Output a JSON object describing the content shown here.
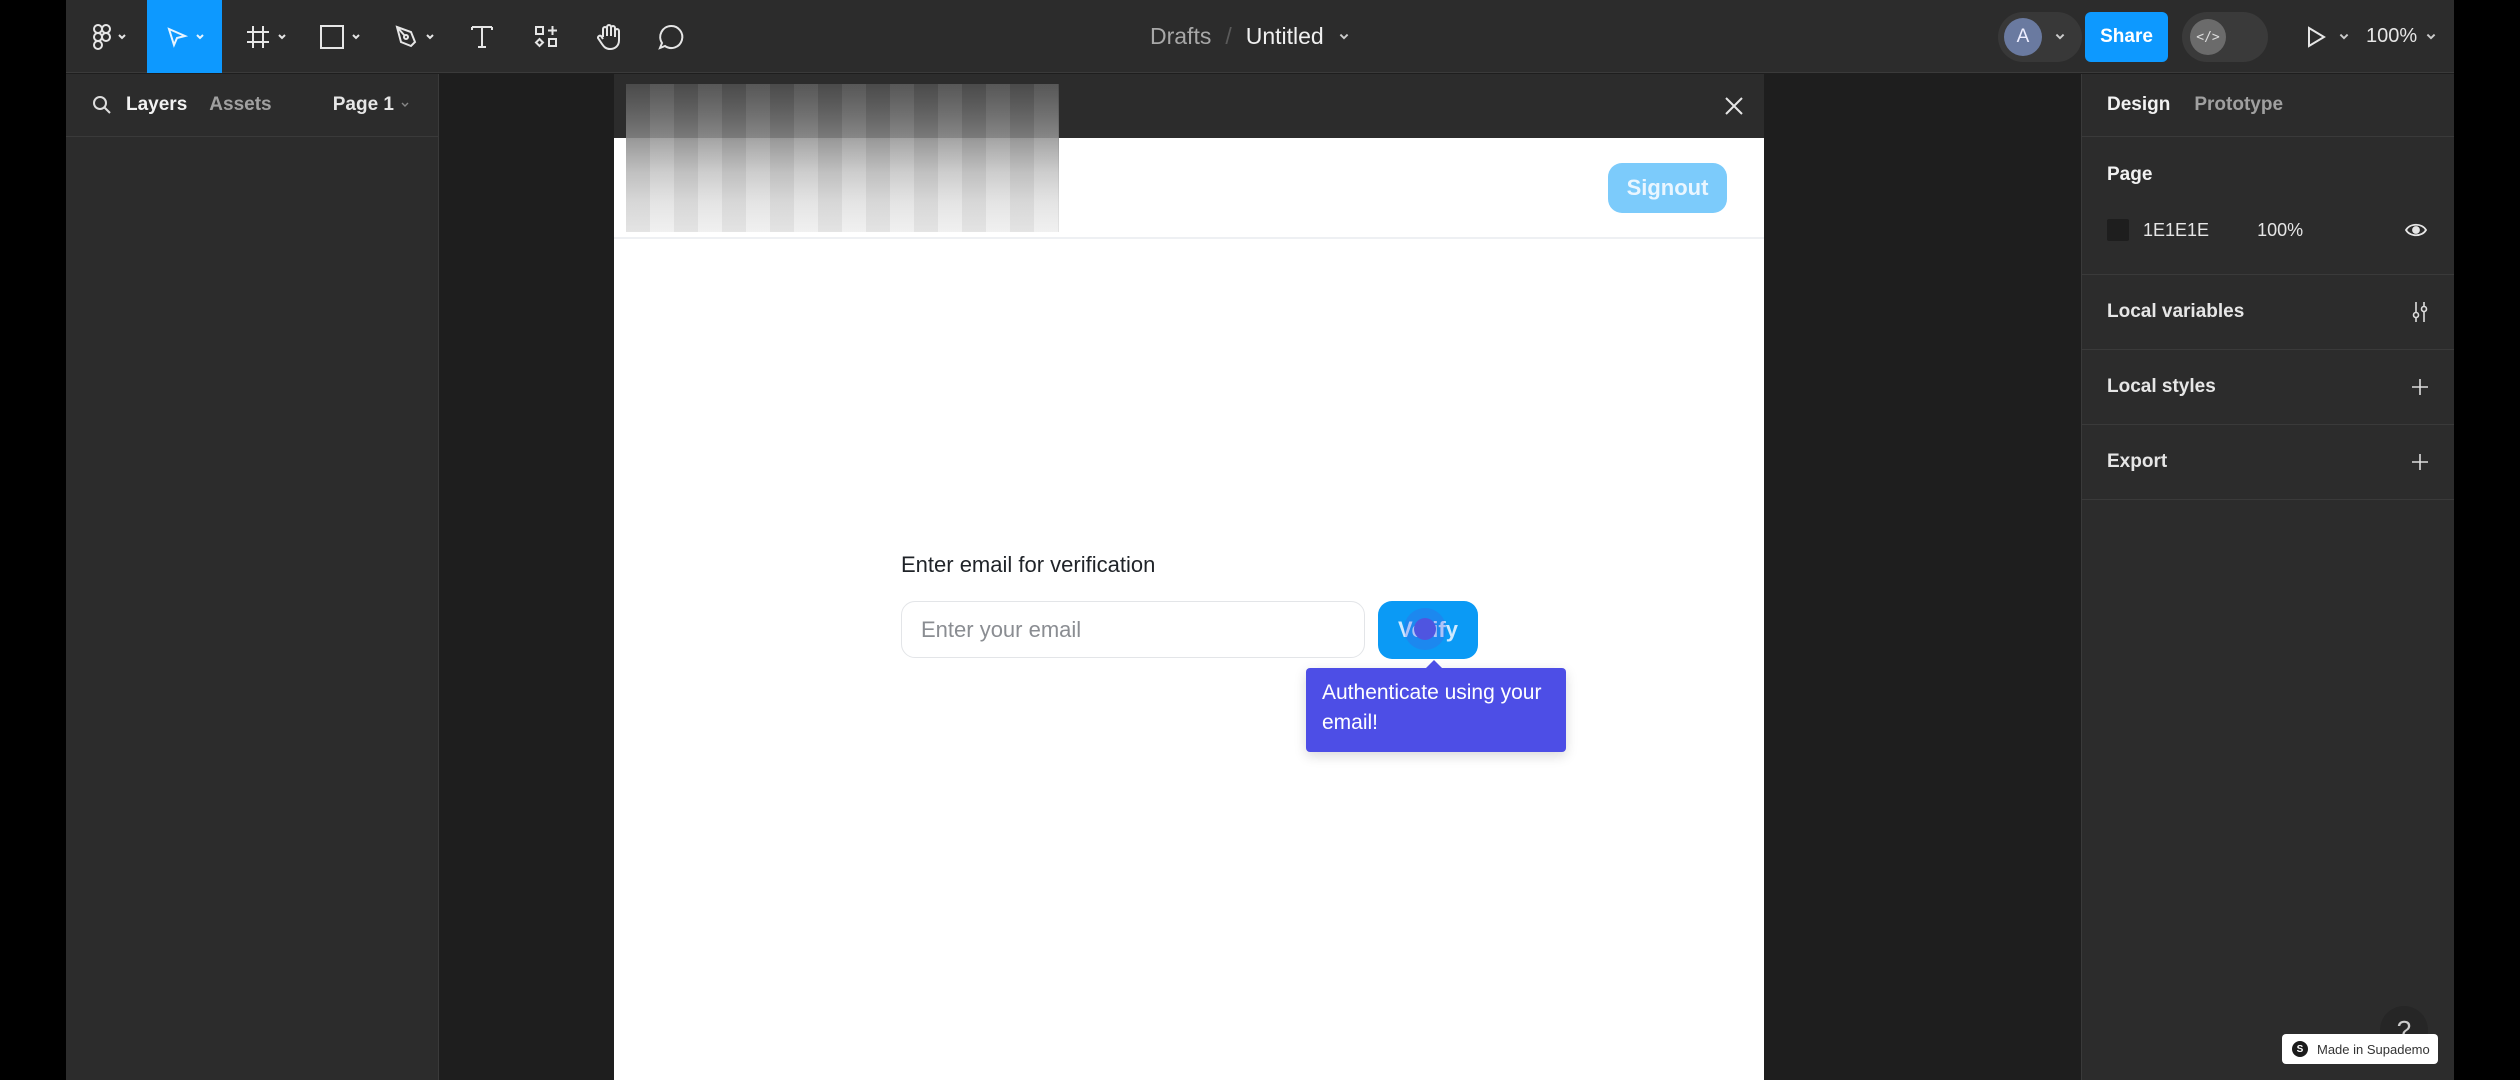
{
  "toolbar": {
    "tools": [
      {
        "name": "main-menu",
        "icon": "figma-logo-icon"
      },
      {
        "name": "move",
        "icon": "cursor-arrow-icon",
        "active": true
      },
      {
        "name": "frame",
        "icon": "frame-hash-icon"
      },
      {
        "name": "shape",
        "icon": "rectangle-icon"
      },
      {
        "name": "pen",
        "icon": "pen-icon"
      },
      {
        "name": "text",
        "icon": "text-icon"
      },
      {
        "name": "resources",
        "icon": "components-icon"
      },
      {
        "name": "hand",
        "icon": "hand-icon"
      },
      {
        "name": "comment",
        "icon": "comment-icon"
      }
    ],
    "breadcrumb": {
      "parent": "Drafts",
      "separator": "/",
      "title": "Untitled"
    },
    "avatar_initial": "A",
    "share_label": "Share",
    "dev_mode_glyph": "</>",
    "zoom_level": "100%",
    "accent_color": "#0d99ff"
  },
  "left_panel": {
    "tabs": [
      "Layers",
      "Assets"
    ],
    "active_tab": "Layers",
    "page_selector": "Page 1"
  },
  "canvas": {
    "frame": {
      "signout_label": "Signout",
      "verify_label": "Enter email for verification",
      "email_placeholder": "Enter your email",
      "email_value": "",
      "verify_button": "Verify",
      "tooltip": "Authenticate using your email!"
    }
  },
  "right_panel": {
    "tabs": [
      "Design",
      "Prototype"
    ],
    "active_tab": "Design",
    "page_section": {
      "title": "Page",
      "color_hex": "1E1E1E",
      "opacity": "100%"
    },
    "sections": [
      {
        "label": "Local variables",
        "icon": "sliders-icon"
      },
      {
        "label": "Local styles",
        "icon": "plus-icon"
      },
      {
        "label": "Export",
        "icon": "plus-icon"
      }
    ]
  },
  "footer": {
    "supademo_badge": "Made in Supademo",
    "supademo_logo": "S",
    "help_glyph": "?"
  }
}
